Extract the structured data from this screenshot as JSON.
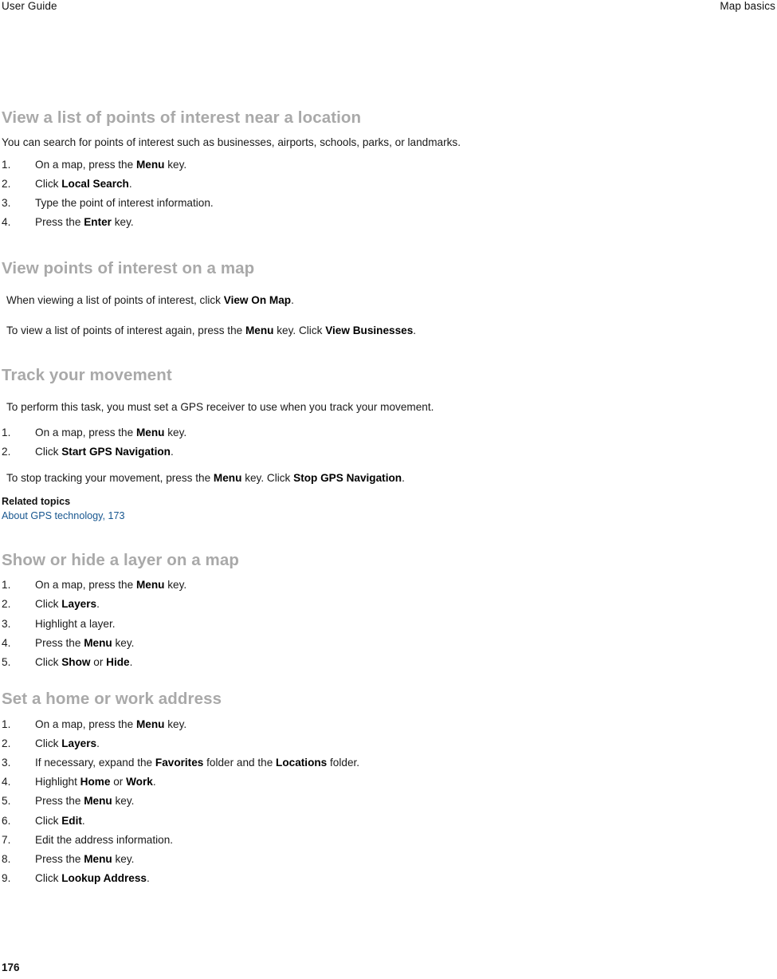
{
  "header": {
    "left": "User Guide",
    "right": "Map basics"
  },
  "footer": {
    "page_number": "176"
  },
  "colors": {
    "heading": "#a9a9a9",
    "body": "#1a1a1a",
    "link": "#17568f",
    "background": "#ffffff"
  },
  "sections": [
    {
      "title": "View a list of points of interest near a location",
      "intro": "You can search for points of interest such as businesses, airports, schools, parks, or landmarks.",
      "steps": [
        {
          "pre": "On a map, press the ",
          "bold": "Menu",
          "post": " key."
        },
        {
          "pre": "Click ",
          "bold": "Local Search",
          "post": "."
        },
        {
          "pre": "Type the point of interest information.",
          "bold": "",
          "post": ""
        },
        {
          "pre": "Press the ",
          "bold": "Enter",
          "post": " key."
        }
      ]
    },
    {
      "title": "View points of interest on a map",
      "para1": {
        "pre": "When viewing a list of points of interest, click ",
        "bold": "View On Map",
        "post": "."
      },
      "para2": {
        "pre": "To view a list of points of interest again, press the ",
        "bold1": "Menu",
        "mid": " key. Click ",
        "bold2": "View Businesses",
        "post": "."
      }
    },
    {
      "title": "Track your movement",
      "intro": "To perform this task, you must set a GPS receiver to use when you track your movement.",
      "steps": [
        {
          "pre": "On a map, press the ",
          "bold": "Menu",
          "post": " key."
        },
        {
          "pre": "Click ",
          "bold": "Start GPS Navigation",
          "post": "."
        }
      ],
      "outro": {
        "pre": "To stop tracking your movement, press the ",
        "bold1": "Menu",
        "mid": " key. Click ",
        "bold2": "Stop GPS Navigation",
        "post": "."
      },
      "related_topics_label": "Related topics",
      "related_topics_link": "About GPS technology, 173"
    },
    {
      "title": "Show or hide a layer on a map",
      "steps": [
        {
          "pre": "On a map, press the ",
          "bold": "Menu",
          "post": " key."
        },
        {
          "pre": "Click ",
          "bold": "Layers",
          "post": "."
        },
        {
          "pre": "Highlight a layer.",
          "bold": "",
          "post": ""
        },
        {
          "pre": "Press the ",
          "bold": "Menu",
          "post": " key."
        },
        {
          "pre": "Click ",
          "bold": "Show",
          "mid": " or ",
          "bold2": "Hide",
          "post": "."
        }
      ]
    },
    {
      "title": "Set a home or work address",
      "steps": [
        {
          "pre": "On a map, press the ",
          "bold": "Menu",
          "post": " key."
        },
        {
          "pre": "Click ",
          "bold": "Layers",
          "post": "."
        },
        {
          "pre": "If necessary, expand the ",
          "bold": "Favorites",
          "mid": " folder and the ",
          "bold2": "Locations",
          "post": " folder."
        },
        {
          "pre": "Highlight ",
          "bold": "Home",
          "mid": " or ",
          "bold2": "Work",
          "post": "."
        },
        {
          "pre": "Press the ",
          "bold": "Menu",
          "post": " key."
        },
        {
          "pre": "Click ",
          "bold": "Edit",
          "post": "."
        },
        {
          "pre": "Edit the address information.",
          "bold": "",
          "post": ""
        },
        {
          "pre": "Press the ",
          "bold": "Menu",
          "post": " key."
        },
        {
          "pre": "Click ",
          "bold": "Lookup Address",
          "post": "."
        }
      ]
    }
  ]
}
